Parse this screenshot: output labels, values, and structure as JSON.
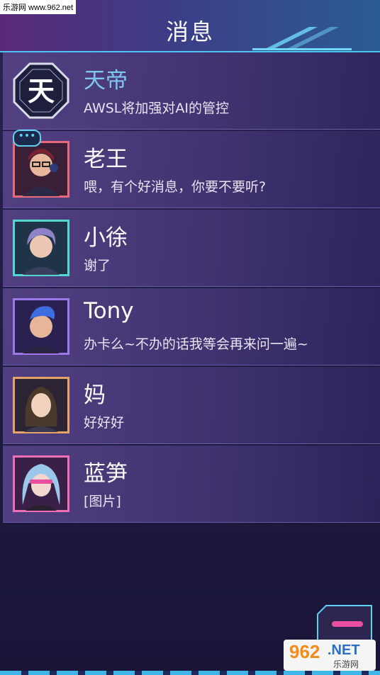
{
  "watermark": "乐游网 www.962.net",
  "header": {
    "title": "消息"
  },
  "conversations": [
    {
      "name": "天帝",
      "message": "AWSL将加强对AI的管控",
      "avatar_icon": "tiandi-logo-icon",
      "avatar_glyph": "天",
      "frame_color": "#cfd2e4",
      "highlight": true
    },
    {
      "name": "老王",
      "message": "喂，有个好消息，你要不要听?",
      "avatar_icon": "laowang-avatar",
      "frame_color": "#e86a7a",
      "has_bubble": true
    },
    {
      "name": "小徐",
      "message": "谢了",
      "avatar_icon": "xiaoxu-avatar",
      "frame_color": "#55d6d0"
    },
    {
      "name": "Tony",
      "message": "办卡么~不办的话我等会再来问一遍~",
      "avatar_icon": "tony-avatar",
      "frame_color": "#9b7ae8"
    },
    {
      "name": "妈",
      "message": "好好好",
      "avatar_icon": "mom-avatar",
      "frame_color": "#e3a36a"
    },
    {
      "name": "蓝笋",
      "message": "[图片]",
      "avatar_icon": "lansun-avatar",
      "frame_color": "#ef6fb4"
    }
  ],
  "bubble_text": "•••",
  "logo": {
    "number": "962",
    "net": ".NET",
    "cn": "乐游网"
  }
}
